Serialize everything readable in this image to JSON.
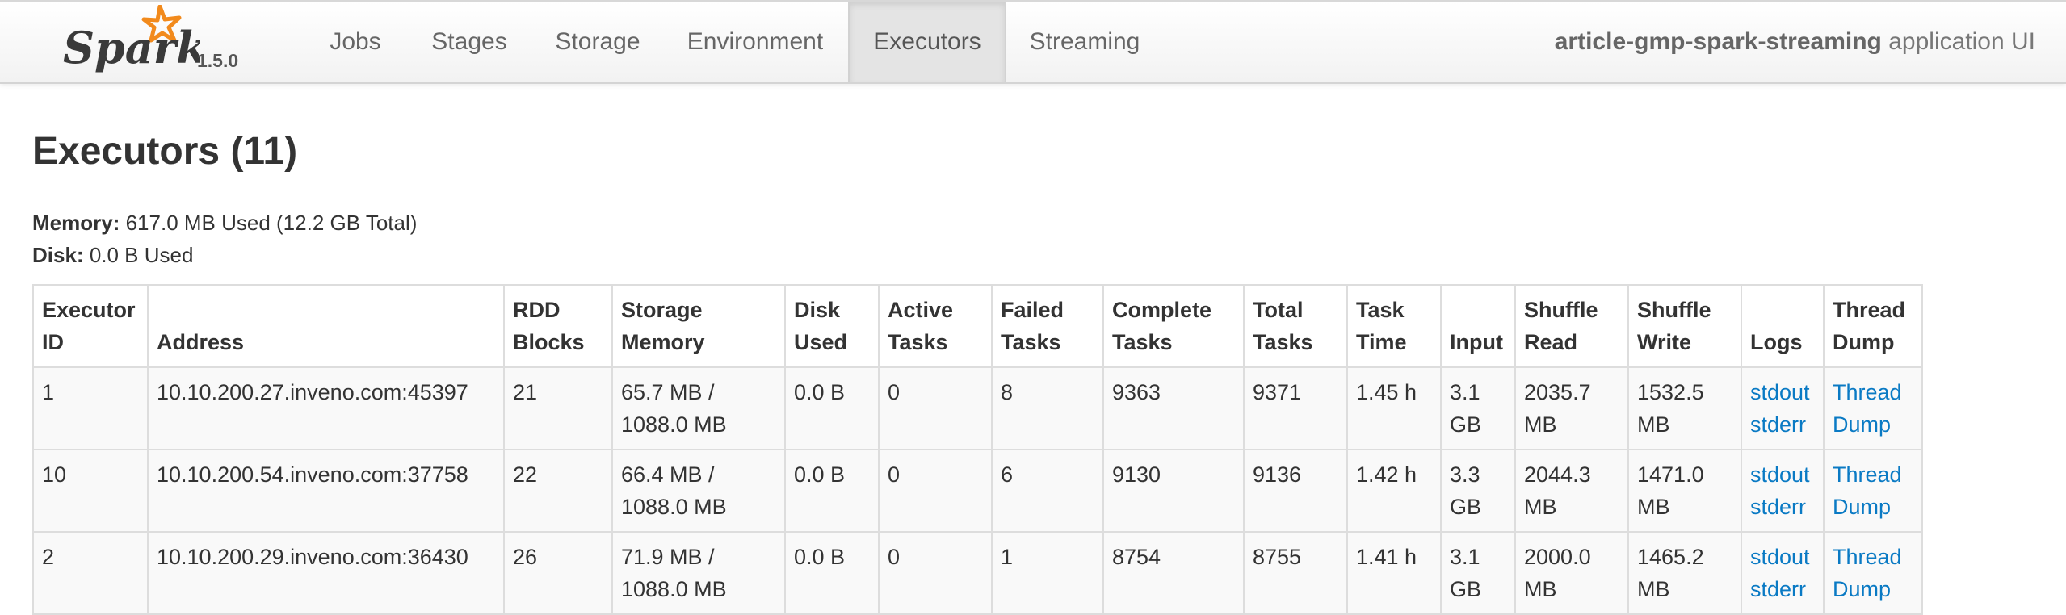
{
  "nav": {
    "version": "1.5.0",
    "tabs": [
      "Jobs",
      "Stages",
      "Storage",
      "Environment",
      "Executors",
      "Streaming"
    ],
    "active_tab": "Executors",
    "app_name": "article-gmp-spark-streaming",
    "app_suffix": "application UI"
  },
  "page": {
    "title": "Executors (11)",
    "memory_label": "Memory:",
    "memory_value": "617.0 MB Used (12.2 GB Total)",
    "disk_label": "Disk:",
    "disk_value": "0.0 B Used"
  },
  "table": {
    "headers": [
      [
        "Executor",
        "ID"
      ],
      [
        "Address"
      ],
      [
        "RDD",
        "Blocks"
      ],
      [
        "Storage",
        "Memory"
      ],
      [
        "Disk",
        "Used"
      ],
      [
        "Active",
        "Tasks"
      ],
      [
        "Failed",
        "Tasks"
      ],
      [
        "Complete",
        "Tasks"
      ],
      [
        "Total",
        "Tasks"
      ],
      [
        "Task",
        "Time"
      ],
      [
        "Input"
      ],
      [
        "Shuffle",
        "Read"
      ],
      [
        "Shuffle",
        "Write"
      ],
      [
        "Logs"
      ],
      [
        "Thread",
        "Dump"
      ]
    ],
    "rows": [
      {
        "executor_id": "1",
        "address": "10.10.200.27.inveno.com:45397",
        "rdd_blocks": "21",
        "storage_memory": [
          "65.7 MB /",
          "1088.0 MB"
        ],
        "disk_used": "0.0 B",
        "active_tasks": "0",
        "failed_tasks": "8",
        "complete_tasks": "9363",
        "total_tasks": "9371",
        "task_time": "1.45 h",
        "input": [
          "3.1",
          "GB"
        ],
        "shuffle_read": [
          "2035.7",
          "MB"
        ],
        "shuffle_write": [
          "1532.5",
          "MB"
        ],
        "logs": [
          "stdout",
          "stderr"
        ],
        "thread_dump": [
          "Thread",
          "Dump"
        ]
      },
      {
        "executor_id": "10",
        "address": "10.10.200.54.inveno.com:37758",
        "rdd_blocks": "22",
        "storage_memory": [
          "66.4 MB /",
          "1088.0 MB"
        ],
        "disk_used": "0.0 B",
        "active_tasks": "0",
        "failed_tasks": "6",
        "complete_tasks": "9130",
        "total_tasks": "9136",
        "task_time": "1.42 h",
        "input": [
          "3.3",
          "GB"
        ],
        "shuffle_read": [
          "2044.3",
          "MB"
        ],
        "shuffle_write": [
          "1471.0",
          "MB"
        ],
        "logs": [
          "stdout",
          "stderr"
        ],
        "thread_dump": [
          "Thread",
          "Dump"
        ]
      },
      {
        "executor_id": "2",
        "address": "10.10.200.29.inveno.com:36430",
        "rdd_blocks": "26",
        "storage_memory": [
          "71.9 MB /",
          "1088.0 MB"
        ],
        "disk_used": "0.0 B",
        "active_tasks": "0",
        "failed_tasks": "1",
        "complete_tasks": "8754",
        "total_tasks": "8755",
        "task_time": "1.41 h",
        "input": [
          "3.1",
          "GB"
        ],
        "shuffle_read": [
          "2000.0",
          "MB"
        ],
        "shuffle_write": [
          "1465.2",
          "MB"
        ],
        "logs": [
          "stdout",
          "stderr"
        ],
        "thread_dump": [
          "Thread",
          "Dump"
        ]
      }
    ]
  },
  "colors": {
    "link": "#0a7ac4",
    "logo_star": "#f28a1c",
    "logo_text": "#3a3a3a"
  }
}
